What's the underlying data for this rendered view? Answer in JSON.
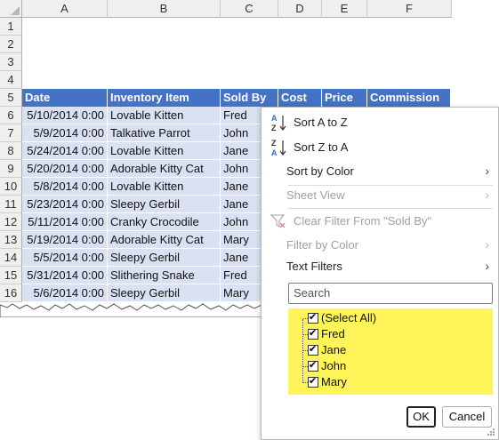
{
  "columns": [
    "A",
    "B",
    "C",
    "D",
    "E",
    "F"
  ],
  "rows": [
    "1",
    "2",
    "3",
    "4",
    "5",
    "6",
    "7",
    "8",
    "9",
    "10",
    "11",
    "12",
    "13",
    "14",
    "15",
    "16"
  ],
  "table_headers": [
    "Date",
    "Inventory Item",
    "Sold By",
    "Cost",
    "Price",
    "Commission"
  ],
  "table_rows": [
    [
      "5/10/2014 0:00",
      "Lovable Kitten",
      "Fred"
    ],
    [
      "5/9/2014 0:00",
      "Talkative Parrot",
      "John"
    ],
    [
      "5/24/2014 0:00",
      "Lovable Kitten",
      "Jane"
    ],
    [
      "5/20/2014 0:00",
      "Adorable Kitty Cat",
      "John"
    ],
    [
      "5/8/2014 0:00",
      "Lovable Kitten",
      "Jane"
    ],
    [
      "5/23/2014 0:00",
      "Sleepy Gerbil",
      "Jane"
    ],
    [
      "5/11/2014 0:00",
      "Cranky Crocodile",
      "John"
    ],
    [
      "5/19/2014 0:00",
      "Adorable Kitty Cat",
      "Mary"
    ],
    [
      "5/5/2014 0:00",
      "Sleepy Gerbil",
      "Jane"
    ],
    [
      "5/31/2014 0:00",
      "Slithering Snake",
      "Fred"
    ],
    [
      "5/6/2014 0:00",
      "Sleepy Gerbil",
      "Mary"
    ]
  ],
  "menu": {
    "sort_az": "Sort A to Z",
    "sort_za": "Sort Z to A",
    "sort_by_color": "Sort by Color",
    "sheet_view": "Sheet View",
    "clear_filter": "Clear Filter From \"Sold By\"",
    "filter_by_color": "Filter by Color",
    "text_filters": "Text Filters",
    "search_placeholder": "Search",
    "filter_items": [
      "(Select All)",
      "Fred",
      "Jane",
      "John",
      "Mary"
    ],
    "ok": "OK",
    "cancel": "Cancel"
  },
  "colors": {
    "header_blue": "#4472c4",
    "band_blue": "#d9e1f2",
    "list_highlight": "#fff55a"
  }
}
